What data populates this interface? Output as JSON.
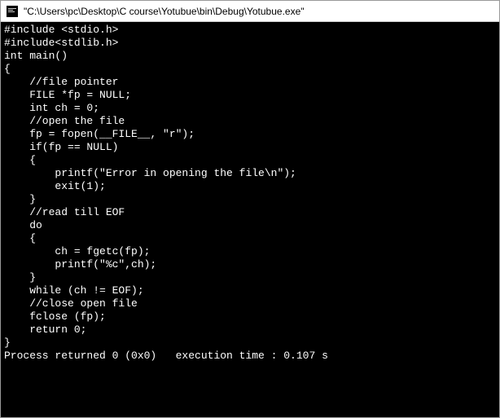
{
  "titlebar": {
    "title": "\"C:\\Users\\pc\\Desktop\\C course\\Yotubue\\bin\\Debug\\Yotubue.exe\""
  },
  "console": {
    "lines": [
      "#include <stdio.h>",
      "#include<stdlib.h>",
      "",
      "int main()",
      "{",
      "    //file pointer",
      "    FILE *fp = NULL;",
      "    int ch = 0;",
      "    //open the file",
      "    fp = fopen(__FILE__, \"r\");",
      "    if(fp == NULL)",
      "    {",
      "        printf(\"Error in opening the file\\n\");",
      "        exit(1);",
      "    }",
      "    //read till EOF",
      "    do",
      "    {",
      "        ch = fgetc(fp);",
      "        printf(\"%c\",ch);",
      "    }",
      "    while (ch != EOF);",
      "",
      "    //close open file",
      "    fclose (fp);",
      "",
      "    return 0;",
      "",
      "}",
      "",
      "Process returned 0 (0x0)   execution time : 0.107 s"
    ]
  }
}
